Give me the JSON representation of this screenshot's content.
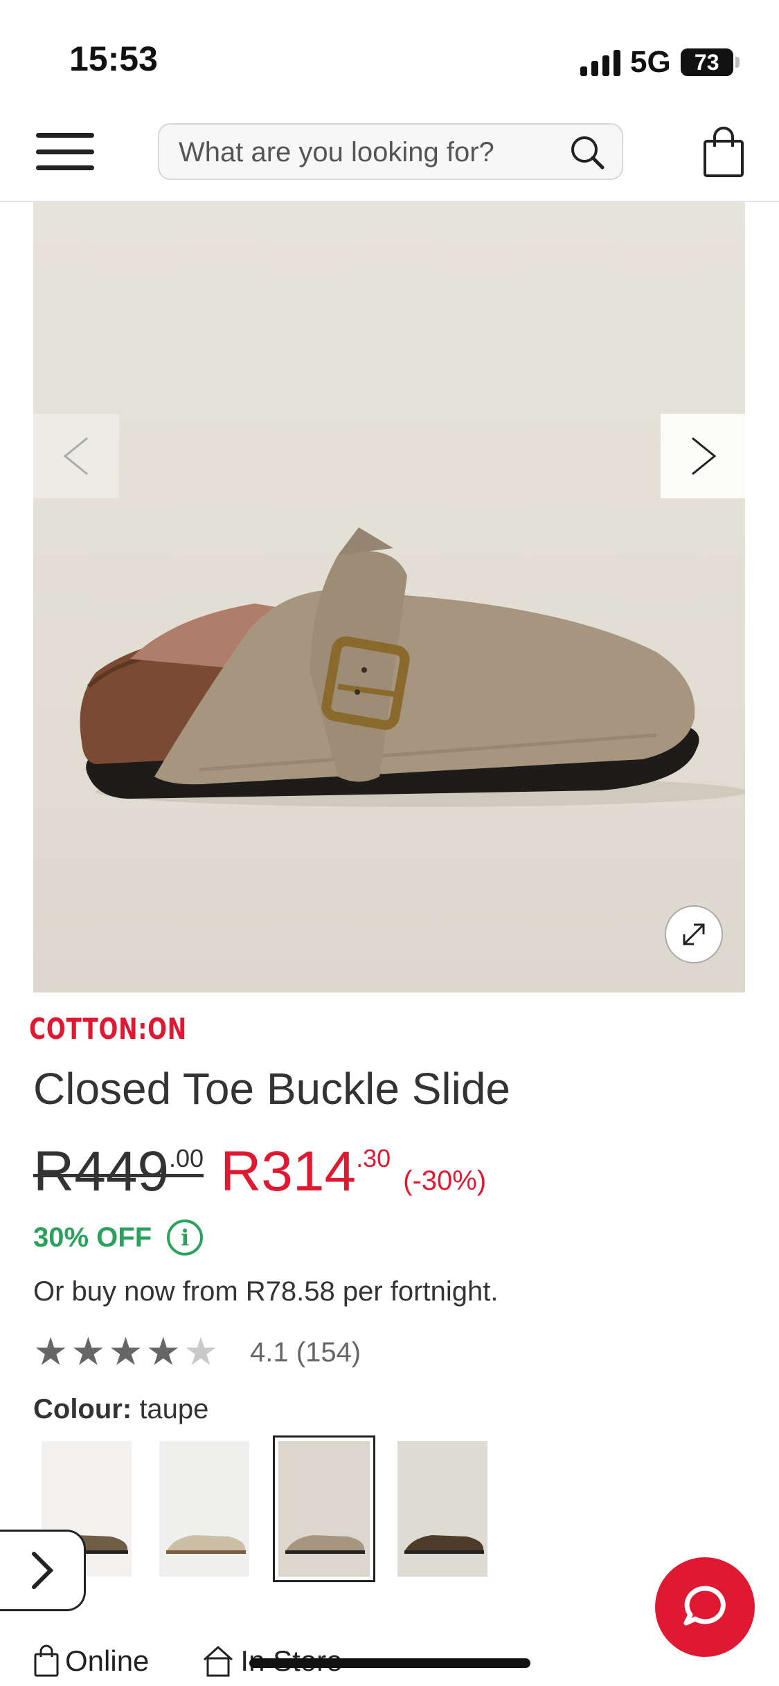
{
  "status_bar": {
    "time": "15:53",
    "network": "5G",
    "battery": "73"
  },
  "header": {
    "search_placeholder": "What are you looking for?"
  },
  "product": {
    "brand": "COTTON:ON",
    "title": "Closed Toe Buckle Slide",
    "old_price_main": "R449",
    "old_price_cents": ".00",
    "new_price_main": "R314",
    "new_price_cents": ".30",
    "discount": "(-30%)",
    "off_label": "30% OFF",
    "finance_text": "Or buy now from R78.58 per fortnight.",
    "rating": 4.1,
    "rating_text": "4.1",
    "review_count": "(154)",
    "colour_label": "Colour:",
    "colour_value": "taupe"
  },
  "swatches": [
    {
      "name": "khaki"
    },
    {
      "name": "cream"
    },
    {
      "name": "taupe",
      "selected": true
    },
    {
      "name": "brown"
    }
  ],
  "bottom_tabs": [
    {
      "label": "Online",
      "icon": "bag-icon"
    },
    {
      "label": "In Store",
      "icon": "store-icon"
    }
  ],
  "colors": {
    "accent": "#e01933",
    "sale_green": "#2ba25c"
  }
}
